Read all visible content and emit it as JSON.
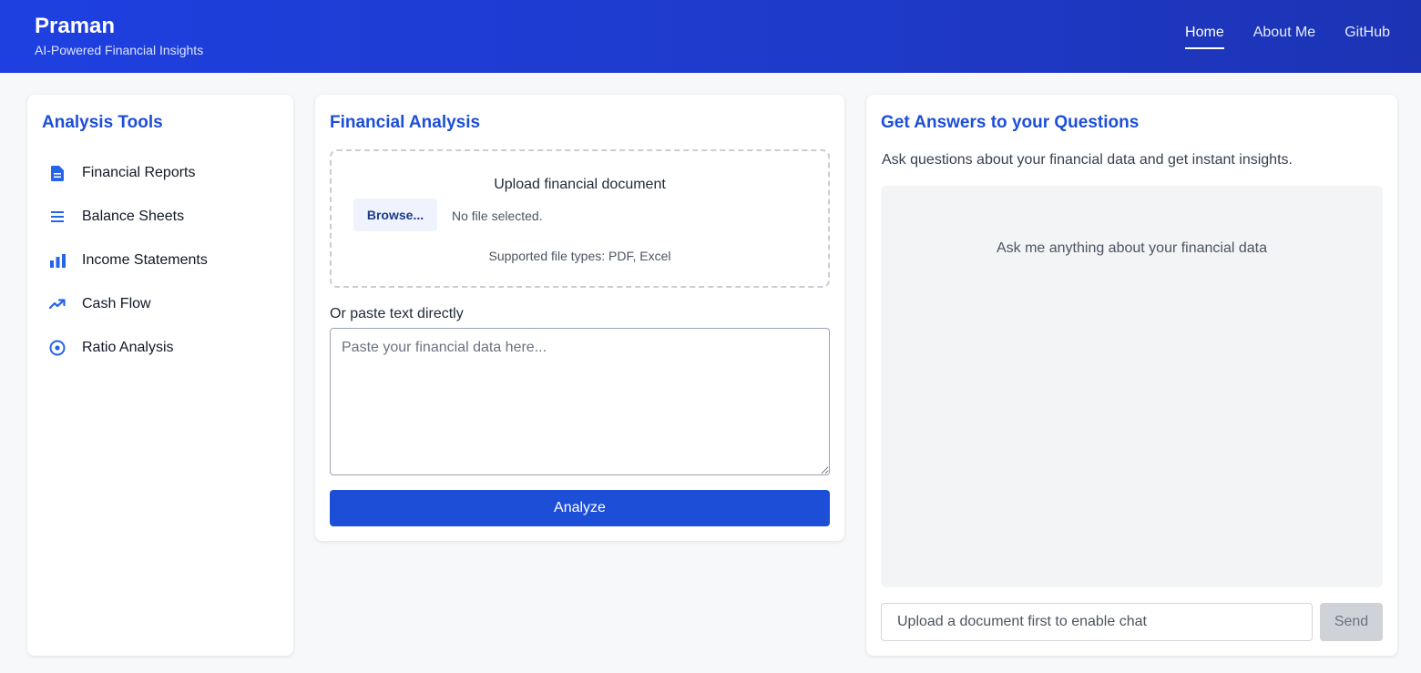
{
  "header": {
    "title": "Praman",
    "subtitle": "AI-Powered Financial Insights",
    "nav": [
      {
        "label": "Home",
        "active": true
      },
      {
        "label": "About Me",
        "active": false
      },
      {
        "label": "GitHub",
        "active": false
      }
    ]
  },
  "sidebar": {
    "title": "Analysis Tools",
    "items": [
      {
        "label": "Financial Reports",
        "icon": "document-icon"
      },
      {
        "label": "Balance Sheets",
        "icon": "list-icon"
      },
      {
        "label": "Income Statements",
        "icon": "bar-chart-icon"
      },
      {
        "label": "Cash Flow",
        "icon": "trending-up-icon"
      },
      {
        "label": "Ratio Analysis",
        "icon": "target-icon"
      }
    ]
  },
  "analysis": {
    "title": "Financial Analysis",
    "upload_title": "Upload financial document",
    "browse_label": "Browse...",
    "file_status": "No file selected.",
    "supported_types": "Supported file types: PDF, Excel",
    "paste_label": "Or paste text directly",
    "paste_placeholder": "Paste your financial data here...",
    "analyze_label": "Analyze"
  },
  "qa": {
    "title": "Get Answers to your Questions",
    "description": "Ask questions about your financial data and get instant insights.",
    "empty_message": "Ask me anything about your financial data",
    "input_placeholder": "Upload a document first to enable chat",
    "send_label": "Send"
  },
  "colors": {
    "accent": "#1d4ed8",
    "header_start": "#1e40e0",
    "header_end": "#1c33b4",
    "icon": "#2563eb"
  }
}
